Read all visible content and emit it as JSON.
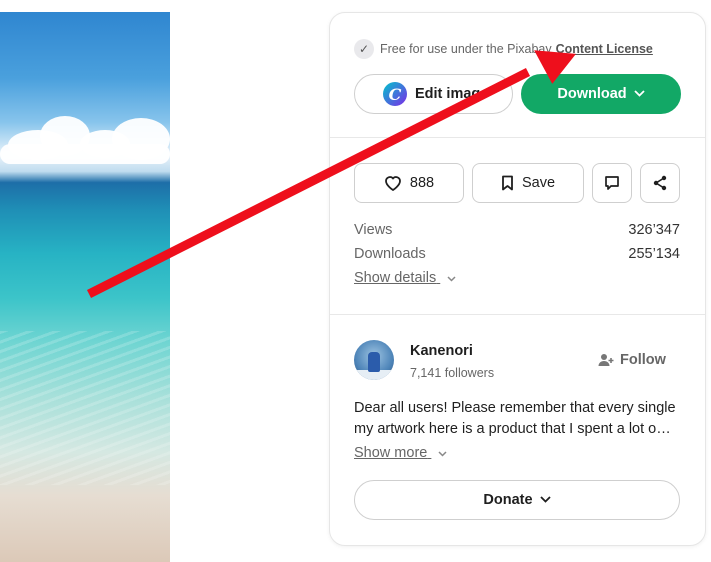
{
  "license": {
    "prefix": "Free for use under the Pixabay",
    "link": "Content License"
  },
  "actions": {
    "edit_label": "Edit image",
    "canva_glyph": "C",
    "download_label": "Download"
  },
  "social": {
    "likes": "888",
    "save_label": "Save"
  },
  "stats": {
    "views_label": "Views",
    "views_value": "326’347",
    "downloads_label": "Downloads",
    "downloads_value": "255’134",
    "show_details": "Show details"
  },
  "author": {
    "name": "Kanenori",
    "followers": "7,141 followers",
    "follow_label": "Follow",
    "bio_line1": "Dear all users! Please remember that every single",
    "bio_line2": "my artwork here is a product that I spent a lot o…",
    "show_more": "Show more",
    "donate_label": "Donate"
  },
  "colors": {
    "download_green": "#12a866",
    "annotation_red": "#ee0f1c"
  },
  "icons": [
    "check-icon",
    "canva-icon",
    "chevron-down-icon",
    "heart-icon",
    "bookmark-icon",
    "comment-icon",
    "share-icon",
    "add-user-icon"
  ]
}
